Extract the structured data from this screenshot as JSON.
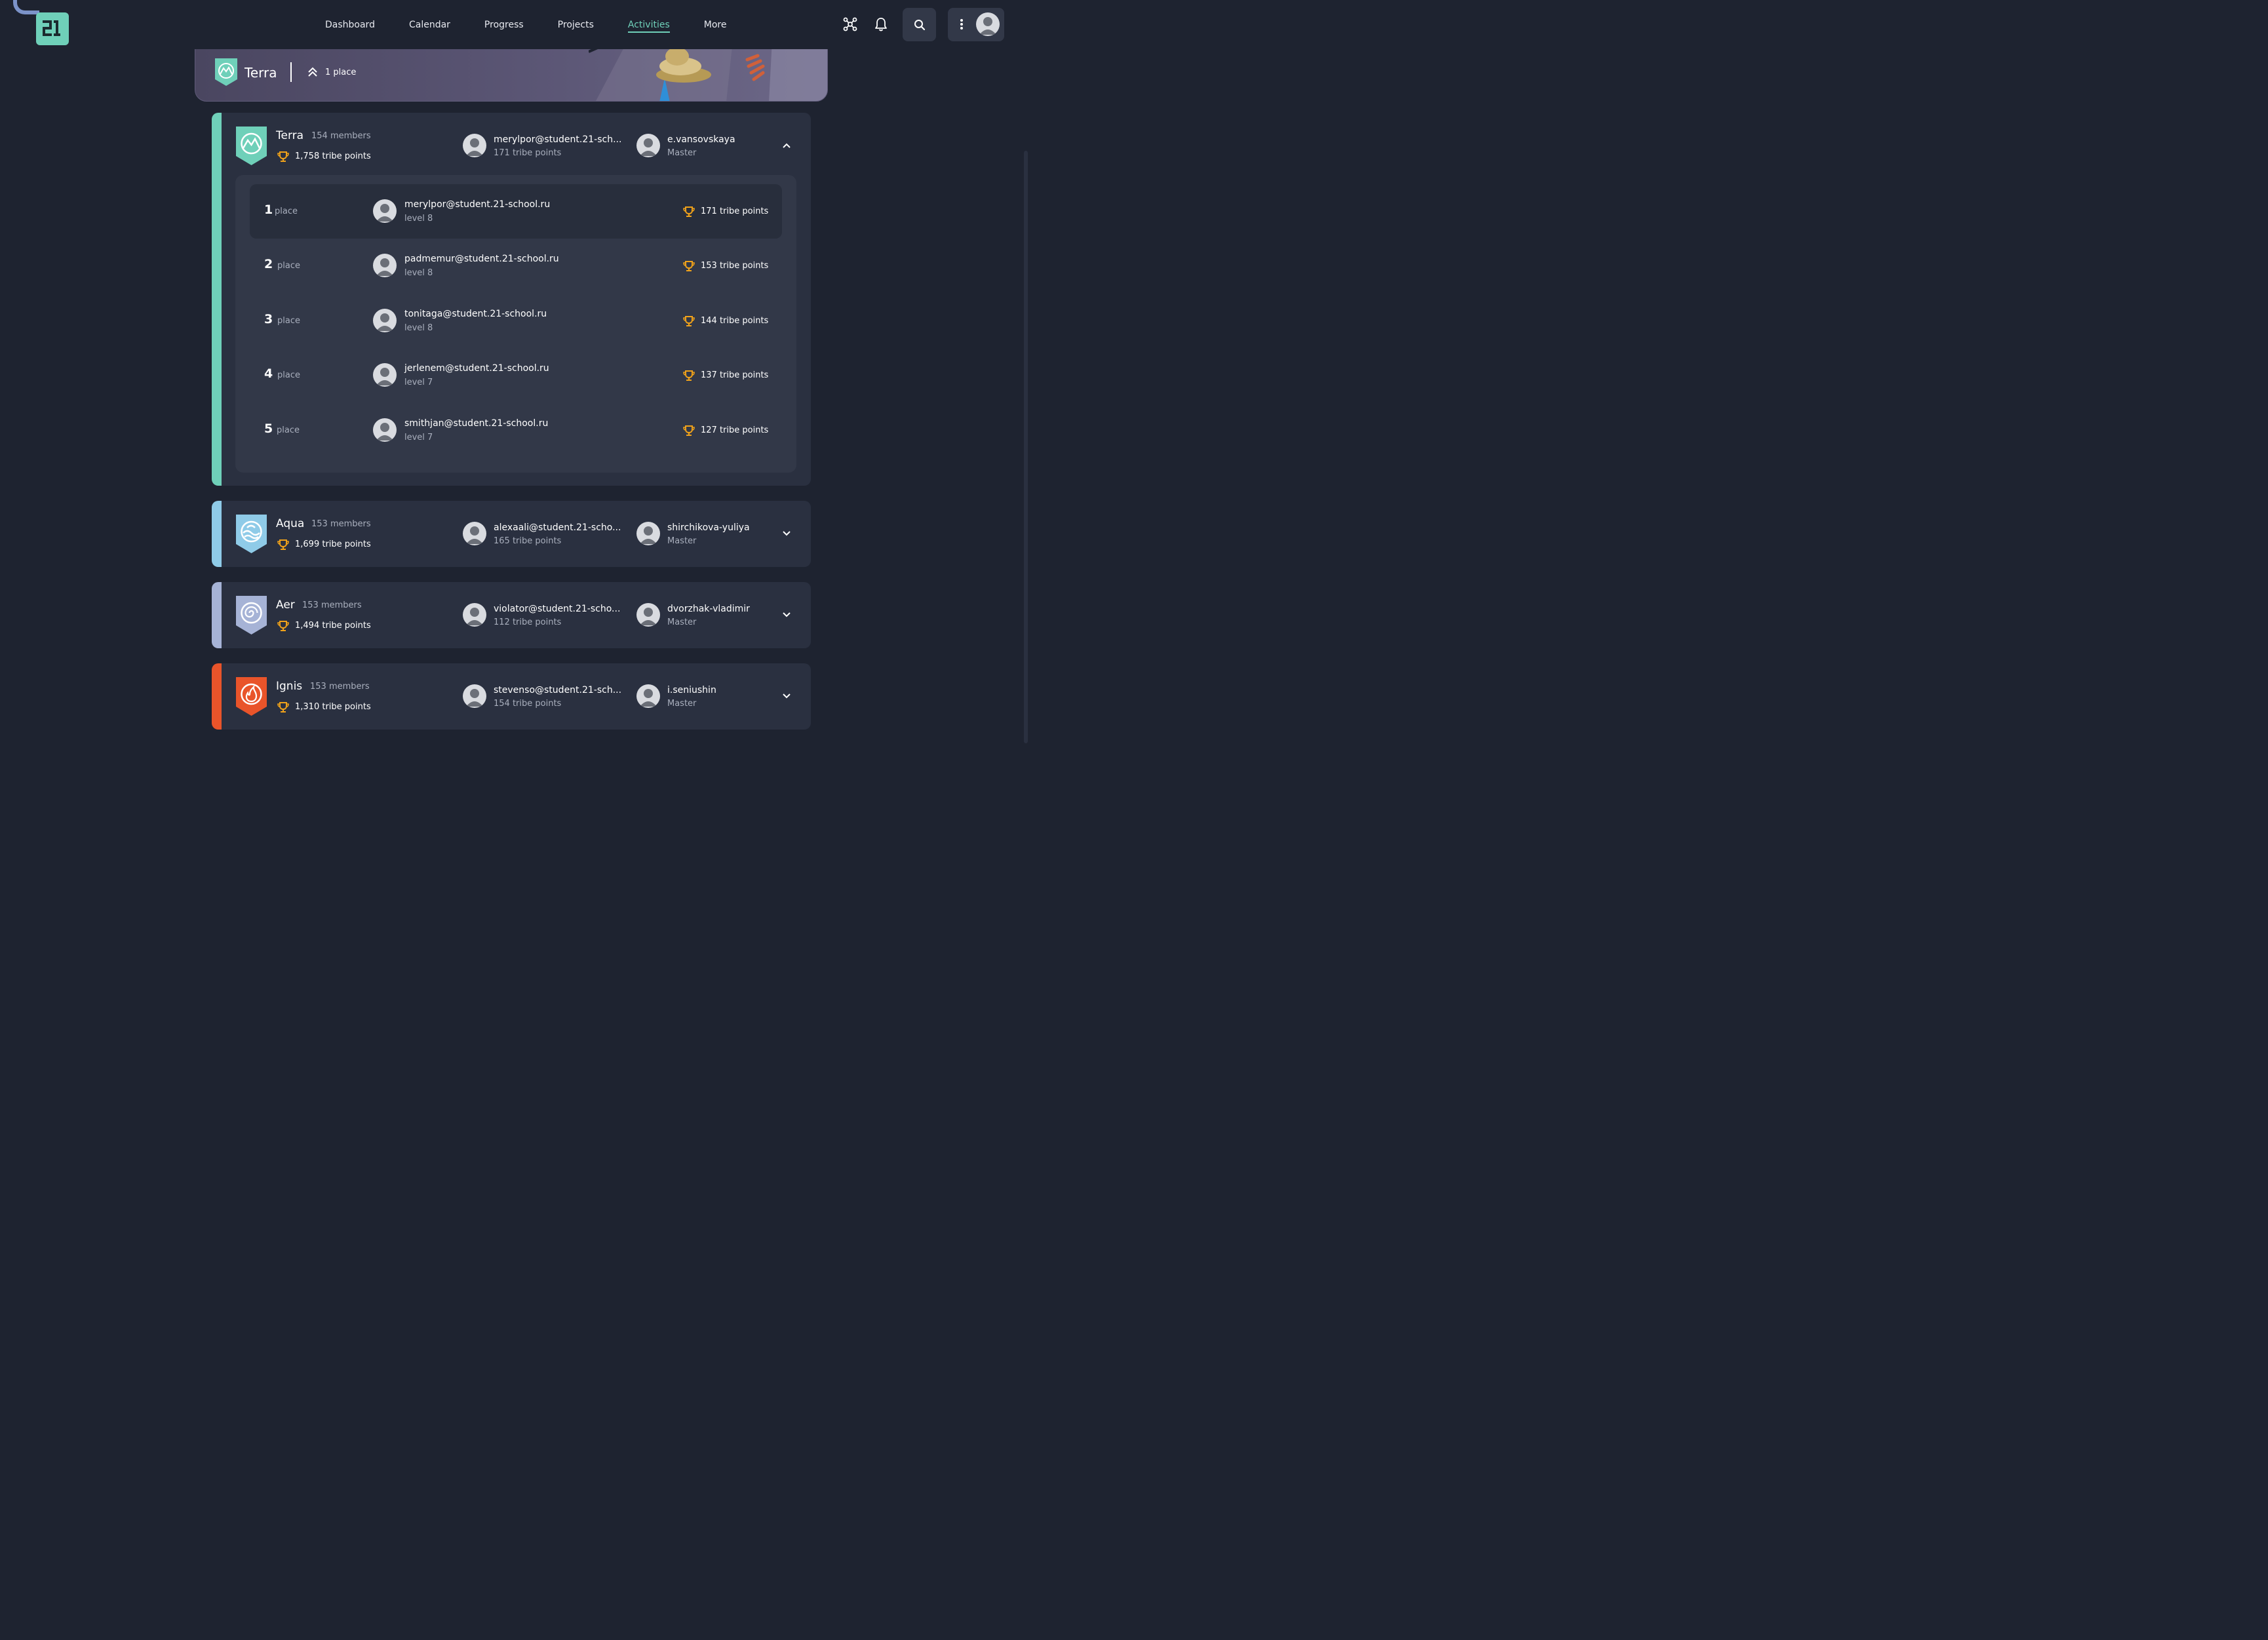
{
  "colors": {
    "background": "#1e2330",
    "card": "#2a3040",
    "accent": "#6fd0b9",
    "trophy": "#f0a21a",
    "terra": "#6fd0b9",
    "aqua": "#8fcbe8",
    "aer": "#a6b3d6",
    "ignis": "#e9542a"
  },
  "nav": {
    "items": [
      {
        "label": "Dashboard"
      },
      {
        "label": "Calendar"
      },
      {
        "label": "Progress"
      },
      {
        "label": "Projects"
      },
      {
        "label": "Activities",
        "active": true
      },
      {
        "label": "More"
      }
    ],
    "icons": [
      "graph-icon",
      "bell-icon",
      "search-icon",
      "more-vertical-icon",
      "avatar"
    ]
  },
  "banner": {
    "title": "Terra",
    "rank": "1 place"
  },
  "tribes": [
    {
      "name": "Terra",
      "members": "154 members",
      "points": "1,758 tribe points",
      "leader_name": "merylpor@student.21-sch...",
      "leader_points": "171 tribe points",
      "master_name": "e.vansovskaya",
      "master_role": "Master",
      "expanded": true,
      "leaderboard": [
        {
          "num": "1",
          "place": "place",
          "name": "merylpor@student.21-school.ru",
          "level": "level 8",
          "points": "171 tribe points"
        },
        {
          "num": "2",
          "place": "place",
          "name": "padmemur@student.21-school.ru",
          "level": "level 8",
          "points": "153 tribe points"
        },
        {
          "num": "3",
          "place": "place",
          "name": "tonitaga@student.21-school.ru",
          "level": "level 8",
          "points": "144 tribe points"
        },
        {
          "num": "4",
          "place": "place",
          "name": "jerlenem@student.21-school.ru",
          "level": "level 7",
          "points": "137 tribe points"
        },
        {
          "num": "5",
          "place": "place",
          "name": "smithjan@student.21-school.ru",
          "level": "level 7",
          "points": "127 tribe points"
        }
      ]
    },
    {
      "name": "Aqua",
      "members": "153 members",
      "points": "1,699 tribe points",
      "leader_name": "alexaali@student.21-scho...",
      "leader_points": "165 tribe points",
      "master_name": "shirchikova-yuliya",
      "master_role": "Master",
      "expanded": false
    },
    {
      "name": "Aer",
      "members": "153 members",
      "points": "1,494 tribe points",
      "leader_name": "violator@student.21-scho...",
      "leader_points": "112 tribe points",
      "master_name": "dvorzhak-vladimir",
      "master_role": "Master",
      "expanded": false
    },
    {
      "name": "Ignis",
      "members": "153 members",
      "points": "1,310 tribe points",
      "leader_name": "stevenso@student.21-sch...",
      "leader_points": "154 tribe points",
      "master_name": "i.seniushin",
      "master_role": "Master",
      "expanded": false
    }
  ]
}
